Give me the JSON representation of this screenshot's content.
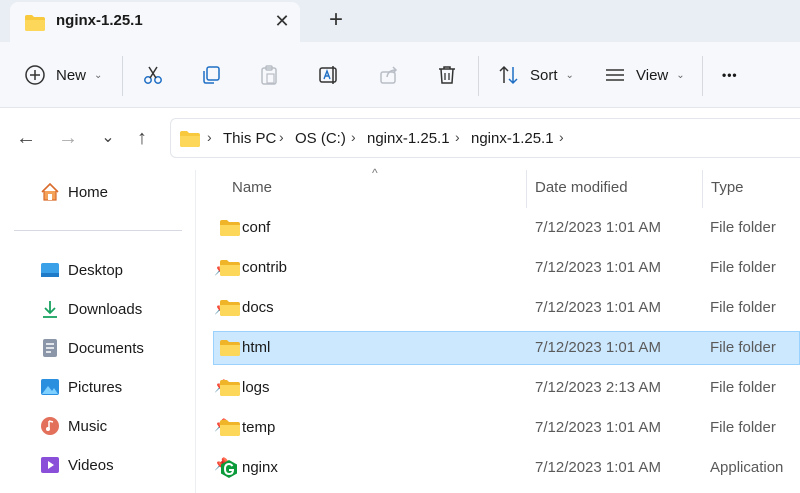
{
  "tab": {
    "title": "nginx-1.25.1",
    "close": "✕",
    "new_tab": "+"
  },
  "toolbar": {
    "new_label": "New",
    "sort_label": "Sort",
    "view_label": "View",
    "more": "•••",
    "dropdown": "⌄"
  },
  "nav": {
    "back": "←",
    "forward": "→",
    "recent": "⌄",
    "up": "↑"
  },
  "breadcrumb": [
    "This PC",
    "OS (C:)",
    "nginx-1.25.1",
    "nginx-1.25.1"
  ],
  "breadcrumb_sep": "›",
  "sidebar": {
    "home": "Home",
    "items": [
      {
        "label": "Desktop",
        "icon": "desktop-icon"
      },
      {
        "label": "Downloads",
        "icon": "downloads-icon"
      },
      {
        "label": "Documents",
        "icon": "documents-icon"
      },
      {
        "label": "Pictures",
        "icon": "pictures-icon"
      },
      {
        "label": "Music",
        "icon": "music-icon"
      },
      {
        "label": "Videos",
        "icon": "videos-icon"
      }
    ]
  },
  "columns": {
    "name": "Name",
    "date": "Date modified",
    "type": "Type"
  },
  "sort_indicator": "^",
  "files": [
    {
      "name": "conf",
      "date": "7/12/2023 1:01 AM",
      "type": "File folder",
      "icon": "folder-icon",
      "selected": false
    },
    {
      "name": "contrib",
      "date": "7/12/2023 1:01 AM",
      "type": "File folder",
      "icon": "folder-icon",
      "selected": false
    },
    {
      "name": "docs",
      "date": "7/12/2023 1:01 AM",
      "type": "File folder",
      "icon": "folder-icon",
      "selected": false
    },
    {
      "name": "html",
      "date": "7/12/2023 1:01 AM",
      "type": "File folder",
      "icon": "folder-icon",
      "selected": true
    },
    {
      "name": "logs",
      "date": "7/12/2023 2:13 AM",
      "type": "File folder",
      "icon": "folder-icon",
      "selected": false
    },
    {
      "name": "temp",
      "date": "7/12/2023 1:01 AM",
      "type": "File folder",
      "icon": "folder-icon",
      "selected": false
    },
    {
      "name": "nginx",
      "date": "7/12/2023 1:01 AM",
      "type": "Application",
      "icon": "nginx-app-icon",
      "selected": false
    }
  ],
  "colors": {
    "accent": "#005fb8",
    "selection": "#cce8ff",
    "selection_border": "#99d1ff",
    "folder": "#f8c93d",
    "nginx": "#0c9b3a"
  }
}
